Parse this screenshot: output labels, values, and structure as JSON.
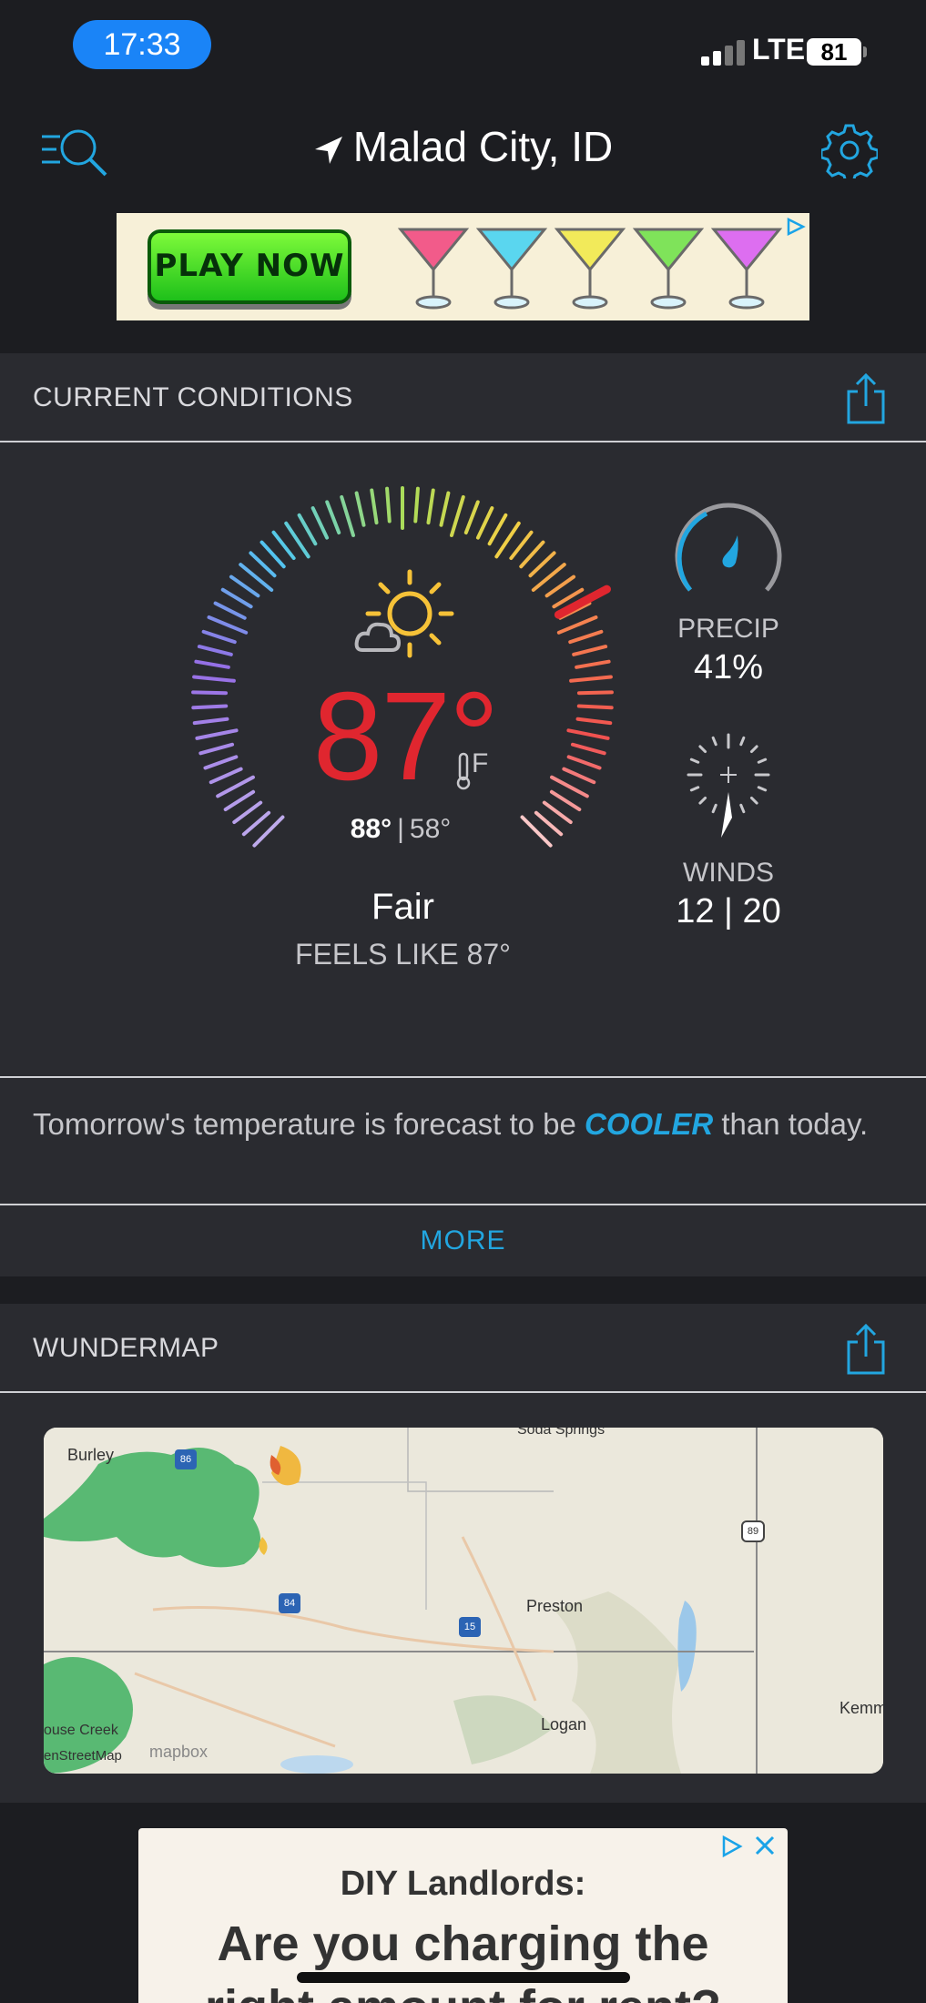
{
  "status_bar": {
    "time": "17:33",
    "network": "LTE",
    "battery": "81"
  },
  "header": {
    "location": "Malad City, ID",
    "menu_icon": "menu-search-icon",
    "settings_icon": "gear-icon"
  },
  "ad_top": {
    "button_label": "PLAY NOW"
  },
  "current_conditions": {
    "title": "CURRENT CONDITIONS",
    "temperature": "87°",
    "unit": "F",
    "high": "88°",
    "low": "58°",
    "separator": "|",
    "condition": "Fair",
    "feels_like": "FEELS LIKE 87°",
    "precip_label": "PRECIP",
    "precip_value": "41%",
    "winds_label": "WINDS",
    "winds_value": "12 | 20"
  },
  "forecast": {
    "text_before": "Tomorrow's temperature is forecast to be ",
    "highlight": "COOLER",
    "text_after": " than today.",
    "more_label": "MORE"
  },
  "wundermap": {
    "title": "WUNDERMAP",
    "labels": {
      "burley": "Burley",
      "preston": "Preston",
      "logan": "Logan",
      "kemmerer": "Kemm",
      "house_creek": "ouse Creek",
      "soda_springs": "Soda Springs",
      "osm": "enStreetMap",
      "mapbox": "mapbox"
    },
    "shields": {
      "i86": "86",
      "i84": "84",
      "i15": "15",
      "us89": "89"
    }
  },
  "ad_bottom": {
    "line1": "DIY Landlords:",
    "line2": "Are you charging the",
    "line3": "right amount for rent?"
  },
  "colors": {
    "accent": "#22a6e0",
    "temp_red": "#e0262f",
    "panel": "#2a2b30",
    "background": "#1c1d21"
  }
}
